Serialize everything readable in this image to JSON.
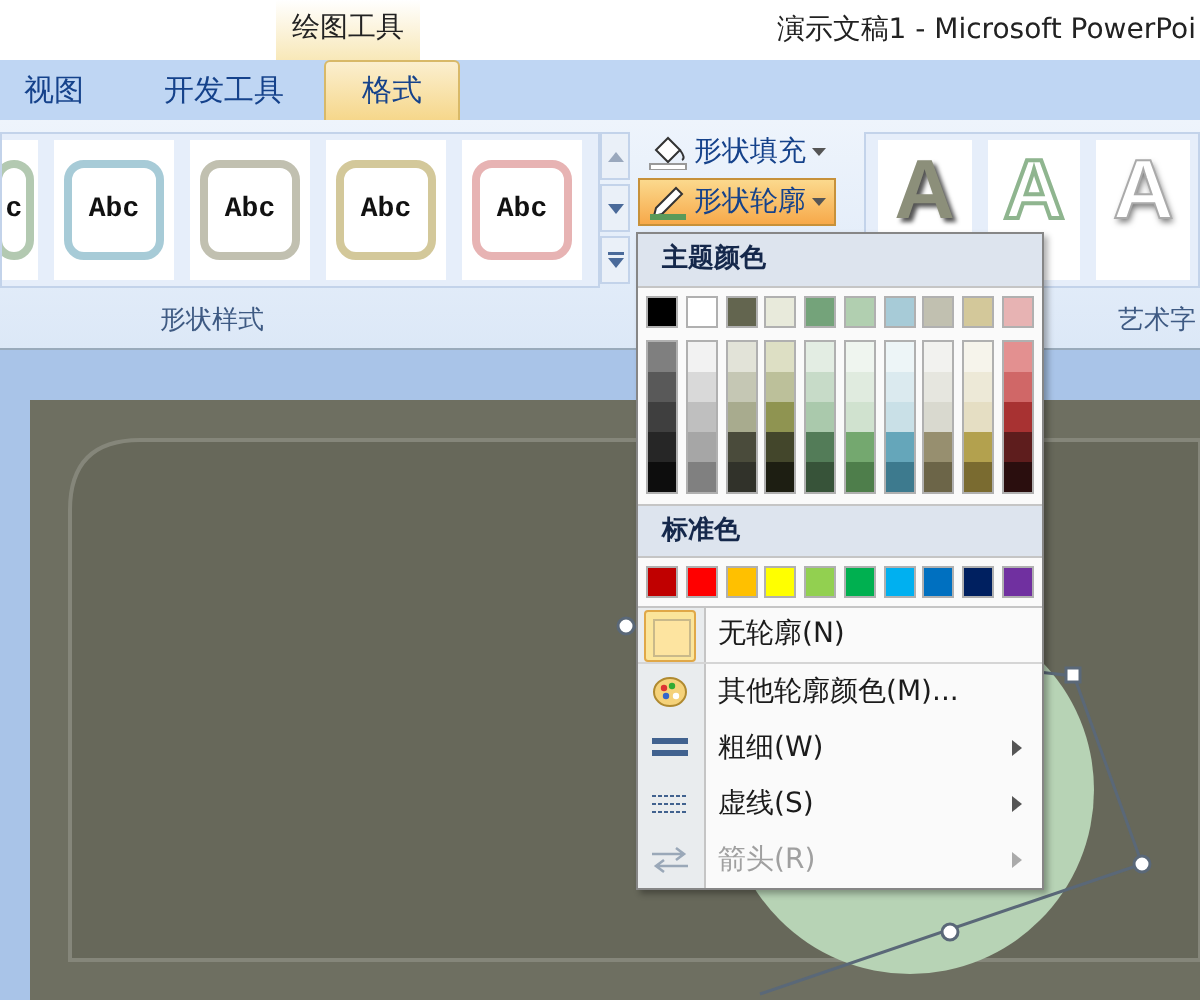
{
  "window": {
    "title": "演示文稿1 - Microsoft PowerPoi"
  },
  "contextual_tab_group": "绘图工具",
  "tabs": [
    {
      "label": "视图",
      "selected": false
    },
    {
      "label": "开发工具",
      "selected": false
    },
    {
      "label": "格式",
      "selected": true
    }
  ],
  "ribbon": {
    "shape_styles": {
      "label": "形状样式",
      "thumbnails": [
        {
          "text": "c",
          "color": "#b3c9b1"
        },
        {
          "text": "Abc",
          "color": "#a7cbd7"
        },
        {
          "text": "Abc",
          "color": "#c1c0b0"
        },
        {
          "text": "Abc",
          "color": "#d3c89a"
        },
        {
          "text": "Abc",
          "color": "#e7b3b3"
        }
      ]
    },
    "shape_buttons": [
      {
        "label": "形状填充",
        "kind": "fill",
        "pressed": false
      },
      {
        "label": "形状轮廓",
        "kind": "outline",
        "pressed": true
      }
    ],
    "wordart_styles": {
      "label": "艺术字",
      "samples": [
        {
          "text": "A",
          "kind": "shadow"
        },
        {
          "text": "A",
          "kind": "outline"
        },
        {
          "text": "A",
          "kind": "white"
        }
      ]
    }
  },
  "outline_menu": {
    "theme_heading": "主题颜色",
    "theme_colors": [
      {
        "color": "#000000"
      },
      {
        "color": "#ffffff"
      },
      {
        "color": "#63654f"
      },
      {
        "color": "#e8eadb"
      },
      {
        "color": "#74a37a"
      },
      {
        "color": "#b1cfb0"
      },
      {
        "color": "#a7cbd7"
      },
      {
        "color": "#c1c0b0"
      },
      {
        "color": "#d3c89a"
      },
      {
        "color": "#e7b3b3"
      }
    ],
    "theme_shades": [
      {
        "shades": [
          {
            "color": "#7f7f7f"
          },
          {
            "color": "#595959"
          },
          {
            "color": "#3f3f3f"
          },
          {
            "color": "#262626"
          },
          {
            "color": "#0d0d0d"
          }
        ]
      },
      {
        "shades": [
          {
            "color": "#f2f2f2"
          },
          {
            "color": "#d9d9d9"
          },
          {
            "color": "#bfbfbf"
          },
          {
            "color": "#a6a6a6"
          },
          {
            "color": "#808080"
          }
        ]
      },
      {
        "shades": [
          {
            "color": "#e2e3d8"
          },
          {
            "color": "#c5c7b4"
          },
          {
            "color": "#a8ab8e"
          },
          {
            "color": "#4a4b3b"
          },
          {
            "color": "#31322a"
          }
        ]
      },
      {
        "shades": [
          {
            "color": "#dddfc4"
          },
          {
            "color": "#bcc09a"
          },
          {
            "color": "#8f9451"
          },
          {
            "color": "#43462b"
          },
          {
            "color": "#1d1e12"
          }
        ]
      },
      {
        "shades": [
          {
            "color": "#e3ede3"
          },
          {
            "color": "#c7dbc8"
          },
          {
            "color": "#aac9ac"
          },
          {
            "color": "#537c58"
          },
          {
            "color": "#375339"
          }
        ]
      },
      {
        "shades": [
          {
            "color": "#eff5ef"
          },
          {
            "color": "#e0ebdf"
          },
          {
            "color": "#d0e2cf"
          },
          {
            "color": "#74a86f"
          },
          {
            "color": "#4e7e4b"
          }
        ]
      },
      {
        "shades": [
          {
            "color": "#edf5f7"
          },
          {
            "color": "#dbeaef"
          },
          {
            "color": "#c9e0e7"
          },
          {
            "color": "#65a6ba"
          },
          {
            "color": "#3d7a8e"
          }
        ]
      },
      {
        "shades": [
          {
            "color": "#f2f2ef"
          },
          {
            "color": "#e6e6df"
          },
          {
            "color": "#d9d9cf"
          },
          {
            "color": "#978f6f"
          },
          {
            "color": "#6c6548"
          }
        ]
      },
      {
        "shades": [
          {
            "color": "#f6f4eb"
          },
          {
            "color": "#ede9d7"
          },
          {
            "color": "#e5dec3"
          },
          {
            "color": "#b3a14e"
          },
          {
            "color": "#7a6b30"
          }
        ]
      },
      {
        "shades": [
          {
            "color": "#e39090"
          },
          {
            "color": "#d06767"
          },
          {
            "color": "#a83232"
          },
          {
            "color": "#5e1d1d"
          },
          {
            "color": "#2a0e0e"
          }
        ]
      }
    ],
    "standard_heading": "标准色",
    "standard_colors": [
      {
        "color": "#c00000"
      },
      {
        "color": "#ff0000"
      },
      {
        "color": "#ffc000"
      },
      {
        "color": "#ffff00"
      },
      {
        "color": "#92d050"
      },
      {
        "color": "#00b050"
      },
      {
        "color": "#00b0f0"
      },
      {
        "color": "#0070c0"
      },
      {
        "color": "#002060"
      },
      {
        "color": "#7030a0"
      }
    ],
    "items": [
      {
        "kind": "none",
        "label": "无轮廓(N)",
        "checked": true,
        "disabled": false,
        "submenu": false
      },
      {
        "kind": "more",
        "label": "其他轮廓颜色(M)...",
        "checked": false,
        "disabled": false,
        "submenu": false
      },
      {
        "kind": "weight",
        "label": "粗细(W)",
        "checked": false,
        "disabled": false,
        "submenu": true
      },
      {
        "kind": "dash",
        "label": "虚线(S)",
        "checked": false,
        "disabled": false,
        "submenu": true
      },
      {
        "kind": "arrows",
        "label": "箭头(R)",
        "checked": false,
        "disabled": true,
        "submenu": true
      }
    ]
  }
}
